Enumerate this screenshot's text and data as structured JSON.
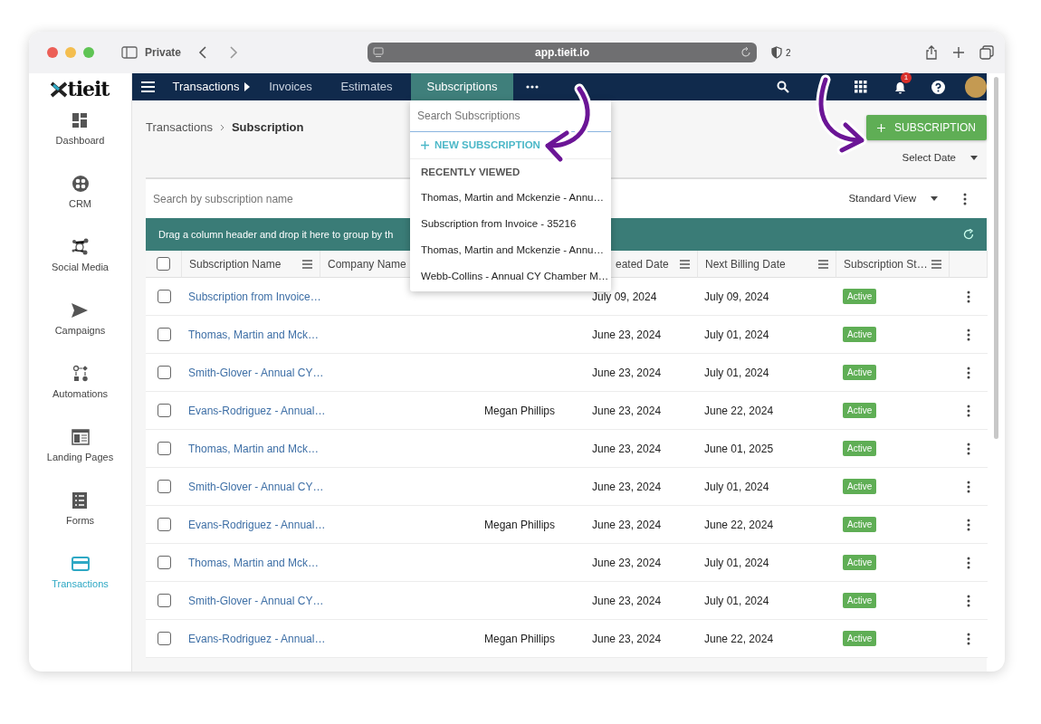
{
  "browser": {
    "private_label": "Private",
    "url": "app.tieit.io",
    "shield_count": "2"
  },
  "logo": {
    "text": "tieit"
  },
  "sidebar": {
    "items": [
      {
        "label": "Dashboard",
        "selected": false
      },
      {
        "label": "CRM",
        "selected": false
      },
      {
        "label": "Social Media",
        "selected": false
      },
      {
        "label": "Campaigns",
        "selected": false
      },
      {
        "label": "Automations",
        "selected": false
      },
      {
        "label": "Landing Pages",
        "selected": false
      },
      {
        "label": "Forms",
        "selected": false
      },
      {
        "label": "Transactions",
        "selected": true
      }
    ]
  },
  "navbar": {
    "tabs": [
      {
        "label": "Transactions",
        "kind": "parent",
        "selected": false
      },
      {
        "label": "Invoices",
        "kind": "plain",
        "selected": false
      },
      {
        "label": "Estimates",
        "kind": "plain",
        "selected": false
      },
      {
        "label": "Subscriptions",
        "kind": "plain",
        "selected": true
      }
    ],
    "notification_count": "1"
  },
  "breadcrumb": [
    "Transactions",
    "Subscription"
  ],
  "add_button": "SUBSCRIPTION",
  "date_filter": "Select Date",
  "search": {
    "placeholder": "Search by subscription name"
  },
  "view_selector": "Standard View",
  "group_bar": "Drag a column header and drop it here to group by th",
  "table": {
    "header_checked": false,
    "columns": [
      {
        "label": "Subscription Name"
      },
      {
        "label": "Company Name"
      },
      {
        "label": "eated Date"
      },
      {
        "label": "Next Billing Date"
      },
      {
        "label": "Subscription St…"
      }
    ],
    "rows": [
      {
        "checked": false,
        "name": "Subscription from Invoice…",
        "created": "July 09, 2024",
        "next_billing": "July 09, 2024",
        "status": "Active"
      },
      {
        "checked": false,
        "name": "Thomas, Martin and Mck…",
        "created": "June 23, 2024",
        "next_billing": "July 01, 2024",
        "status": "Active"
      },
      {
        "checked": false,
        "name": "Smith-Glover - Annual CY…",
        "created": "June 23, 2024",
        "next_billing": "July 01, 2024",
        "status": "Active"
      },
      {
        "checked": false,
        "name": "Evans-Rodriguez - Annual…",
        "contact": "Megan Phillips",
        "created": "June 23, 2024",
        "next_billing": "June 22, 2024",
        "status": "Active"
      },
      {
        "checked": false,
        "name": "Thomas, Martin and Mck…",
        "created": "June 23, 2024",
        "next_billing": "June 01, 2025",
        "status": "Active"
      },
      {
        "checked": false,
        "name": "Smith-Glover - Annual CY…",
        "created": "June 23, 2024",
        "next_billing": "July 01, 2024",
        "status": "Active"
      },
      {
        "checked": false,
        "name": "Evans-Rodriguez - Annual…",
        "contact": "Megan Phillips",
        "created": "June 23, 2024",
        "next_billing": "June 22, 2024",
        "status": "Active"
      },
      {
        "checked": false,
        "name": "Thomas, Martin and Mck…",
        "created": "June 23, 2024",
        "next_billing": "July 01, 2024",
        "status": "Active"
      },
      {
        "checked": false,
        "name": "Smith-Glover - Annual CY…",
        "created": "June 23, 2024",
        "next_billing": "July 01, 2024",
        "status": "Active"
      },
      {
        "checked": false,
        "name": "Evans-Rodriguez - Annual…",
        "contact": "Megan Phillips",
        "created": "June 23, 2024",
        "next_billing": "June 22, 2024",
        "status": "Active"
      }
    ]
  },
  "dropdown": {
    "search_placeholder": "Search Subscriptions",
    "new_label": "NEW SUBSCRIPTION",
    "section_title": "RECENTLY VIEWED",
    "items": [
      "Thomas, Martin and Mckenzie - Annu…",
      "Subscription from Invoice - 35216",
      "Thomas, Martin and Mckenzie - Annu…",
      "Webb-Collins - Annual CY Chamber M…"
    ]
  }
}
